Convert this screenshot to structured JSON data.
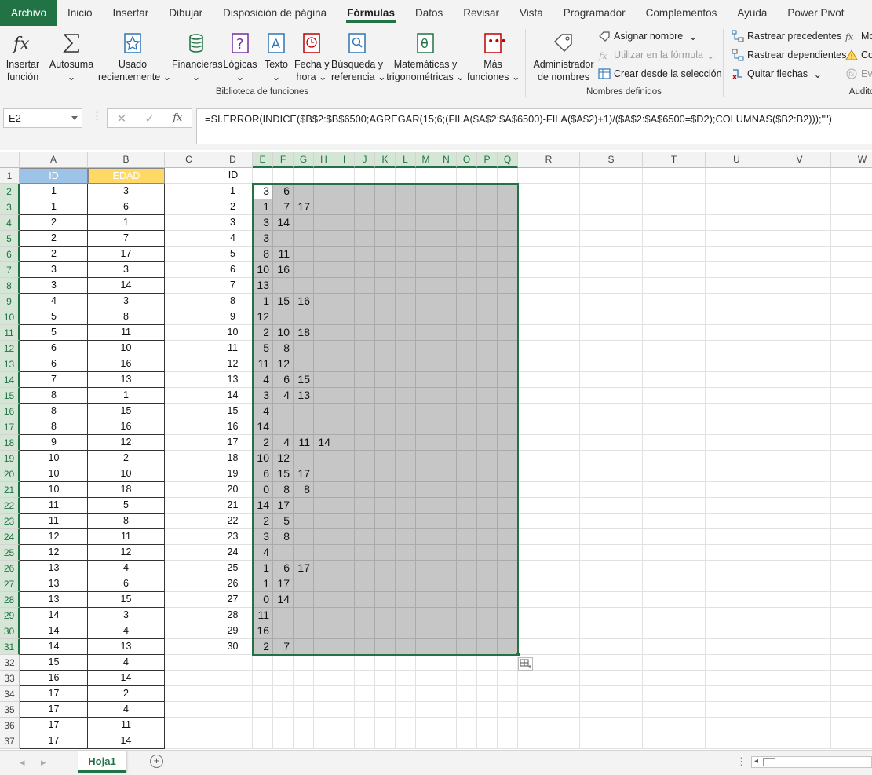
{
  "ribbon_tabs": [
    "Archivo",
    "Inicio",
    "Insertar",
    "Dibujar",
    "Disposición de página",
    "Fórmulas",
    "Datos",
    "Revisar",
    "Vista",
    "Programador",
    "Complementos",
    "Ayuda",
    "Power Pivot"
  ],
  "active_tab": "Fórmulas",
  "library": {
    "insert_fn": [
      "Insertar",
      "función"
    ],
    "autosum": "Autosuma",
    "recent": [
      "Usado",
      "recientemente"
    ],
    "financial": "Financieras",
    "logical": "Lógicas",
    "text": "Texto",
    "datetime": [
      "Fecha y",
      "hora"
    ],
    "lookup": [
      "Búsqueda y",
      "referencia"
    ],
    "math": [
      "Matemáticas y",
      "trigonométricas"
    ],
    "more": [
      "Más",
      "funciones"
    ],
    "group_label": "Biblioteca de funciones"
  },
  "names": {
    "manager": [
      "Administrador",
      "de nombres"
    ],
    "assign": "Asignar nombre",
    "use_in_formula": "Utilizar en la fórmula",
    "create_from_sel": "Crear desde la selección",
    "group_label": "Nombres definidos"
  },
  "audit": {
    "trace_prec": "Rastrear precedentes",
    "trace_dep": "Rastrear dependientes",
    "remove_arrows": "Quitar flechas",
    "show_formulas": "Mo",
    "error_check": "Co",
    "evaluate": "Eva",
    "group_label": "Auditor"
  },
  "formula_bar": {
    "name_box": "E2",
    "fx": "fx",
    "formula": "=SI.ERROR(INDICE($B$2:$B$6500;AGREGAR(15;6;(FILA($A$2:$A$6500)-FILA($A$2)+1)/($A$2:$A$6500=$D2);COLUMNAS($B2:B2)));\"\")"
  },
  "columns": [
    "A",
    "B",
    "C",
    "D",
    "E",
    "F",
    "G",
    "H",
    "I",
    "J",
    "K",
    "L",
    "M",
    "N",
    "O",
    "P",
    "Q",
    "R",
    "S",
    "T",
    "U",
    "V",
    "W"
  ],
  "headers": {
    "A": "ID",
    "B": "EDAD",
    "D": "ID"
  },
  "table_ab": [
    [
      1,
      3
    ],
    [
      1,
      6
    ],
    [
      2,
      1
    ],
    [
      2,
      7
    ],
    [
      2,
      17
    ],
    [
      3,
      3
    ],
    [
      3,
      14
    ],
    [
      4,
      3
    ],
    [
      5,
      8
    ],
    [
      5,
      11
    ],
    [
      6,
      10
    ],
    [
      6,
      16
    ],
    [
      7,
      13
    ],
    [
      8,
      1
    ],
    [
      8,
      15
    ],
    [
      8,
      16
    ],
    [
      9,
      12
    ],
    [
      10,
      2
    ],
    [
      10,
      10
    ],
    [
      10,
      18
    ],
    [
      11,
      5
    ],
    [
      11,
      8
    ],
    [
      12,
      11
    ],
    [
      12,
      12
    ],
    [
      13,
      4
    ],
    [
      13,
      6
    ],
    [
      13,
      15
    ],
    [
      14,
      3
    ],
    [
      14,
      4
    ],
    [
      14,
      13
    ],
    [
      15,
      4
    ],
    [
      16,
      14
    ],
    [
      17,
      2
    ],
    [
      17,
      4
    ],
    [
      17,
      11
    ],
    [
      17,
      14
    ]
  ],
  "col_d": [
    1,
    2,
    3,
    4,
    5,
    6,
    7,
    8,
    9,
    10,
    11,
    12,
    13,
    14,
    15,
    16,
    17,
    18,
    19,
    20,
    21,
    22,
    23,
    24,
    25,
    26,
    27,
    28,
    29,
    30
  ],
  "results": [
    [
      3,
      6
    ],
    [
      1,
      7,
      17
    ],
    [
      3,
      14
    ],
    [
      3
    ],
    [
      8,
      11
    ],
    [
      10,
      16
    ],
    [
      13
    ],
    [
      1,
      15,
      16
    ],
    [
      12
    ],
    [
      2,
      10,
      18
    ],
    [
      5,
      8
    ],
    [
      11,
      12
    ],
    [
      4,
      6,
      15
    ],
    [
      3,
      4,
      13
    ],
    [
      4
    ],
    [
      14
    ],
    [
      2,
      4,
      11,
      14
    ],
    [
      10,
      12
    ],
    [
      6,
      15,
      17
    ],
    [
      0,
      8,
      8
    ],
    [
      14,
      17
    ],
    [
      2,
      5
    ],
    [
      3,
      8
    ],
    [
      4
    ],
    [
      1,
      6,
      17
    ],
    [
      1,
      17
    ],
    [
      0,
      14
    ],
    [
      11
    ],
    [
      16
    ],
    [
      2,
      7
    ]
  ],
  "sheet_tab": "Hoja1",
  "add_sheet": "+"
}
